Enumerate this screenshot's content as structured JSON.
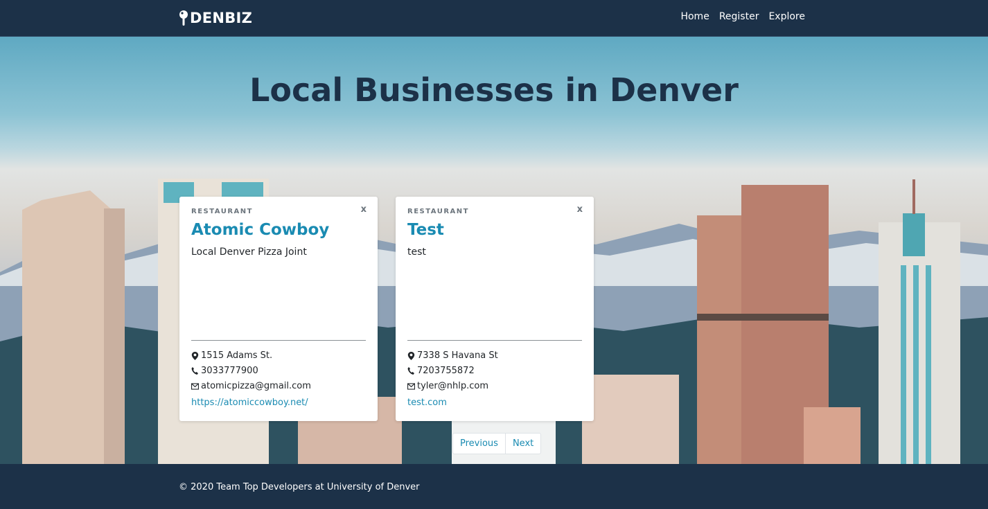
{
  "navbar": {
    "brand": "DENBIZ",
    "brand_icon": "map-pin-icon",
    "links": [
      "Home",
      "Register",
      "Explore"
    ]
  },
  "hero": {
    "title": "Local Businesses in Denver"
  },
  "cards": [
    {
      "category": "RESTAURANT",
      "close": "x",
      "name": "Atomic Cowboy",
      "description": "Local Denver Pizza Joint",
      "address": "1515 Adams St.",
      "phone": "3033777900",
      "email": "atomicpizza@gmail.com",
      "website": "https://atomiccowboy.net/"
    },
    {
      "category": "RESTAURANT",
      "close": "x",
      "name": "Test",
      "description": "test",
      "address": "7338 S Havana St",
      "phone": "7203755872",
      "email": "tyler@nhlp.com",
      "website": "test.com"
    }
  ],
  "pagination": {
    "previous": "Previous",
    "next": "Next"
  },
  "footer": {
    "text": "© 2020 Team Top Developers at University of Denver"
  },
  "colors": {
    "navy": "#1c3148",
    "link": "#1a8bb2"
  }
}
